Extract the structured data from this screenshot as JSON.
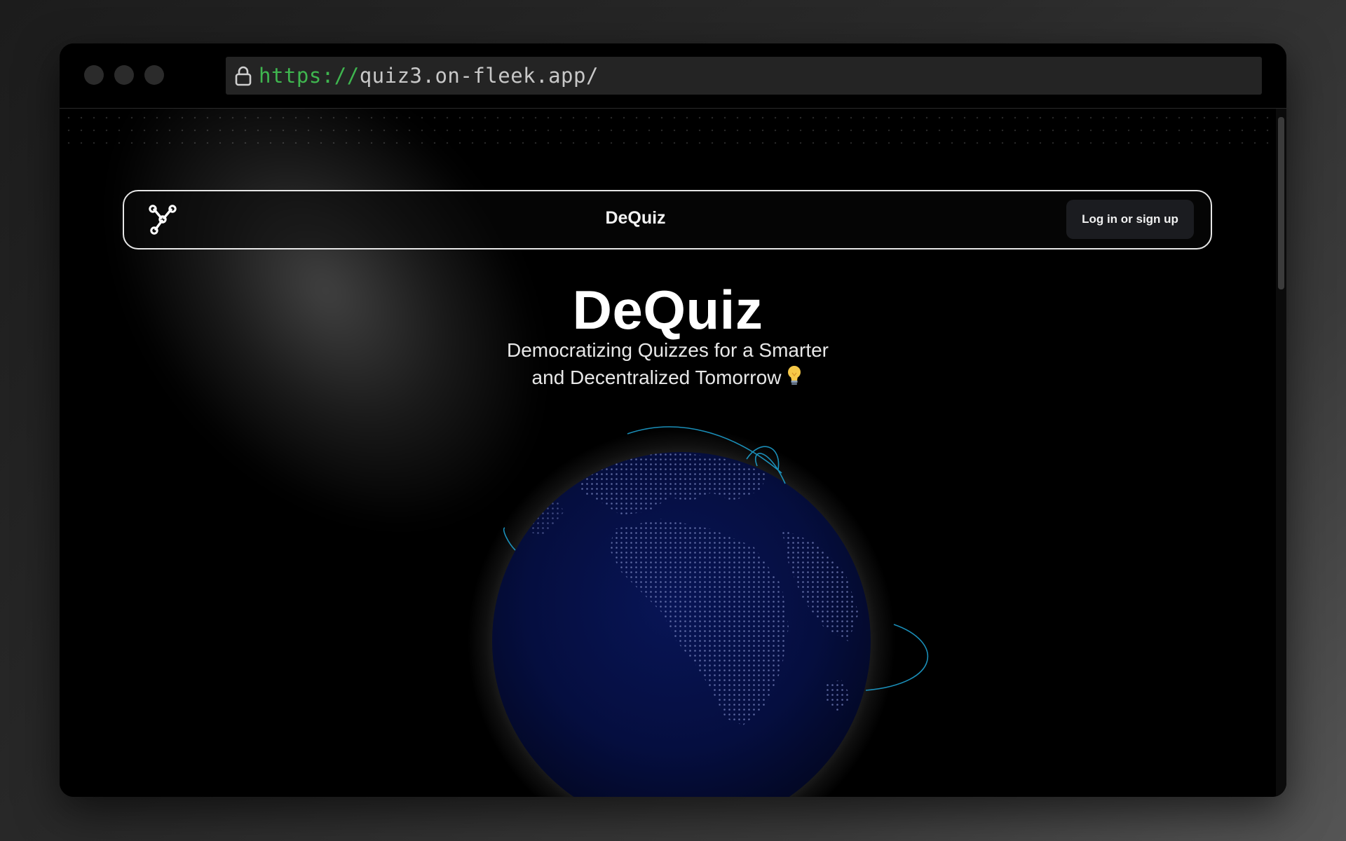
{
  "browser": {
    "url_scheme": "https://",
    "url_host": "quiz3.on-fleek.app/"
  },
  "navbar": {
    "brand": "DeQuiz",
    "login_label": "Log in or sign up"
  },
  "hero": {
    "title": "DeQuiz",
    "subtitle_line1": "Democratizing Quizzes for a Smarter",
    "subtitle_line2": "and Decentralized Tomorrow",
    "subtitle_emoji": "💡"
  },
  "colors": {
    "page_bg": "#000000",
    "url_scheme": "#3fb64f",
    "url_host": "#c8c8c8",
    "globe": "#06104a",
    "arcs": "#1fa7d8"
  },
  "icons": {
    "lock": "lock-icon",
    "logo": "network-nodes-icon",
    "bulb": "lightbulb-icon"
  }
}
